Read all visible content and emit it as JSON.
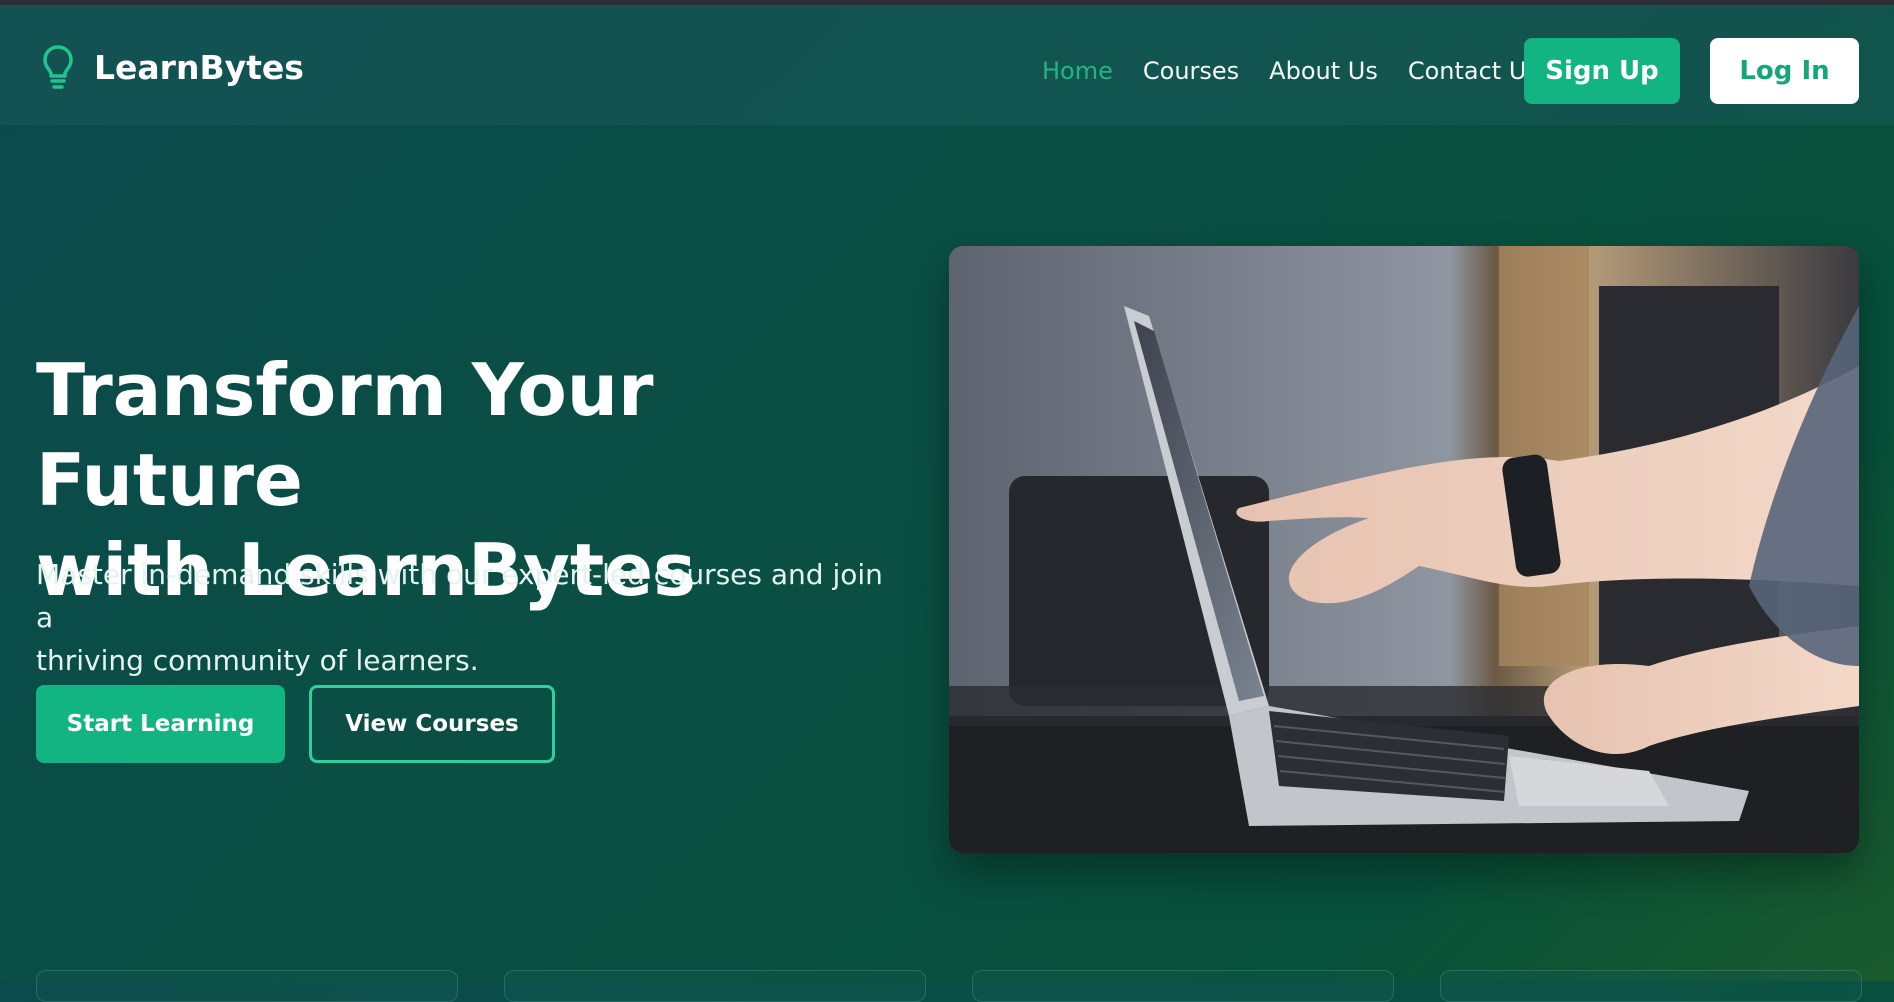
{
  "brand": {
    "name": "LearnBytes",
    "icon": "lightbulb-icon"
  },
  "nav": {
    "links": [
      {
        "label": "Home",
        "active": true
      },
      {
        "label": "Courses",
        "active": false
      },
      {
        "label": "About Us",
        "active": false
      },
      {
        "label": "Contact Us",
        "active": false
      }
    ],
    "signup_label": "Sign Up",
    "login_label": "Log In"
  },
  "hero": {
    "title_line1": "Transform Your Future",
    "title_line2": "with LearnBytes",
    "subtitle_line1": "Master in-demand skills with our expert-led courses and join a",
    "subtitle_line2": "thriving community of learners.",
    "primary_cta": "Start Learning",
    "secondary_cta": "View Courses"
  },
  "colors": {
    "accent": "#12b481",
    "accent_light": "#2fd09a",
    "background_dark": "#0b4a4d",
    "background_green": "#075039"
  }
}
